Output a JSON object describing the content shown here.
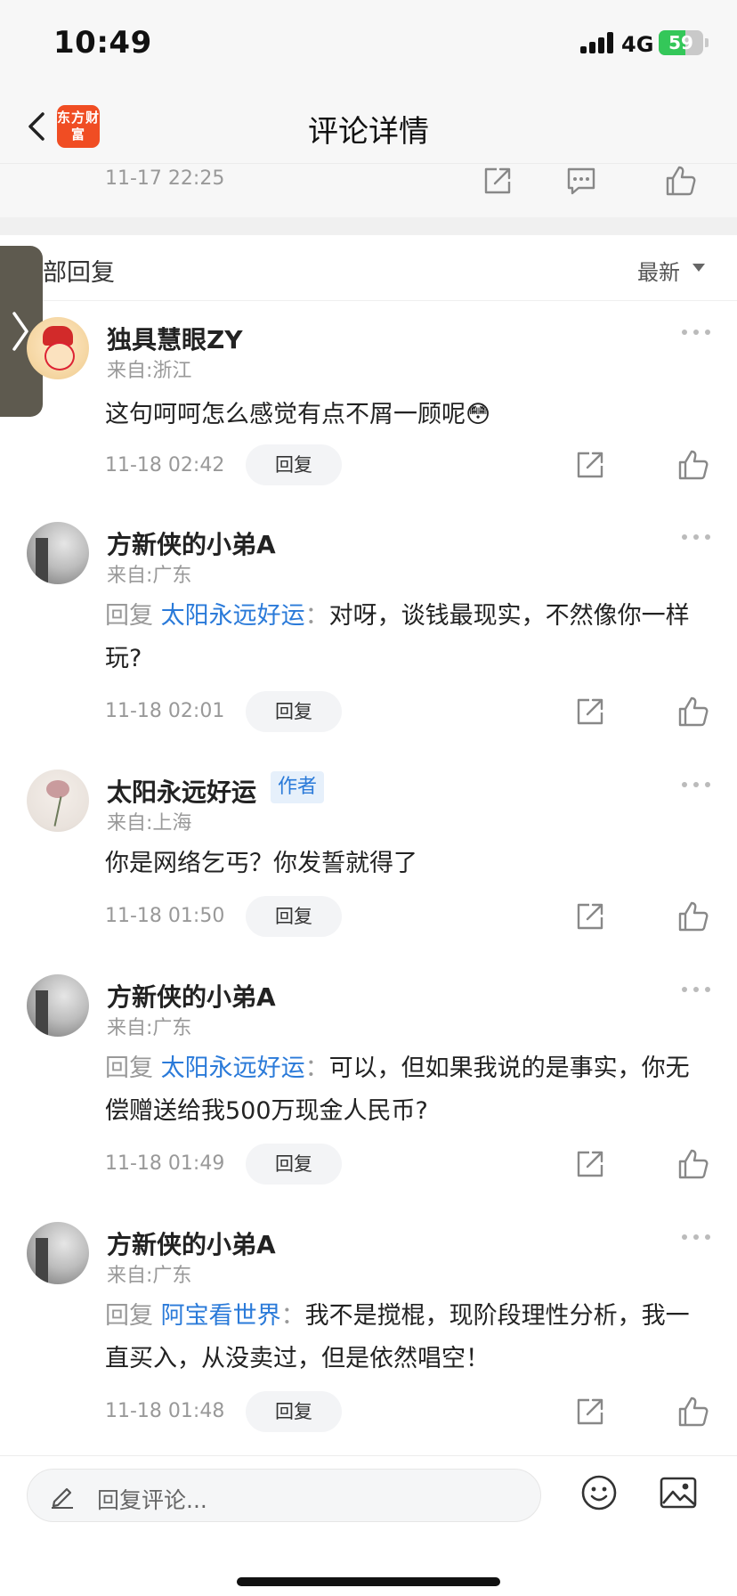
{
  "status_bar": {
    "time": "10:49",
    "network": "4G",
    "battery": "59",
    "battery_percent": 59
  },
  "nav": {
    "title": "评论详情",
    "logo_text": "东方财富"
  },
  "previous": {
    "time": "11-17 22:25"
  },
  "section": {
    "title": "部回复",
    "sort_label": "最新"
  },
  "comments": [
    {
      "username": "独具慧眼ZY",
      "location": "来自:浙江",
      "text": "这句呵呵怎么感觉有点不屑一顾呢😳",
      "time": "11-18 02:42",
      "reply_label": "回复"
    },
    {
      "username": "方新侠的小弟A",
      "location": "来自:广东",
      "reply_prefix": "回复",
      "reply_target": "太阳永远好运",
      "reply_colon": "：",
      "text": "对呀，谈钱最现实，不然像你一样玩?",
      "time": "11-18 02:01",
      "reply_label": "回复"
    },
    {
      "username": "太阳永远好运",
      "badge": "作者",
      "location": "来自:上海",
      "text": "你是网络乞丐？你发誓就得了",
      "time": "11-18 01:50",
      "reply_label": "回复"
    },
    {
      "username": "方新侠的小弟A",
      "location": "来自:广东",
      "reply_prefix": "回复",
      "reply_target": "太阳永远好运",
      "reply_colon": "：",
      "text": "可以，但如果我说的是事实，你无偿赠送给我500万现金人民币?",
      "time": "11-18 01:49",
      "reply_label": "回复"
    },
    {
      "username": "方新侠的小弟A",
      "location": "来自:广东",
      "reply_prefix": "回复",
      "reply_target": "阿宝看世界",
      "reply_colon": "：",
      "text": "我不是搅棍，现阶段理性分析，我一直买入，从没卖过，但是依然唱空！",
      "time": "11-18 01:48",
      "reply_label": "回复"
    }
  ],
  "input": {
    "placeholder": "回复评论..."
  },
  "icons": [
    "back-icon",
    "share-icon",
    "chat-icon",
    "like-icon",
    "more-icon",
    "pencil-icon",
    "emoji-icon",
    "image-icon",
    "chevron-right-icon",
    "signal-icon",
    "battery-icon"
  ],
  "colors": {
    "link": "#2a7ad9",
    "brand": "#f04d23",
    "battery": "#34c759"
  }
}
